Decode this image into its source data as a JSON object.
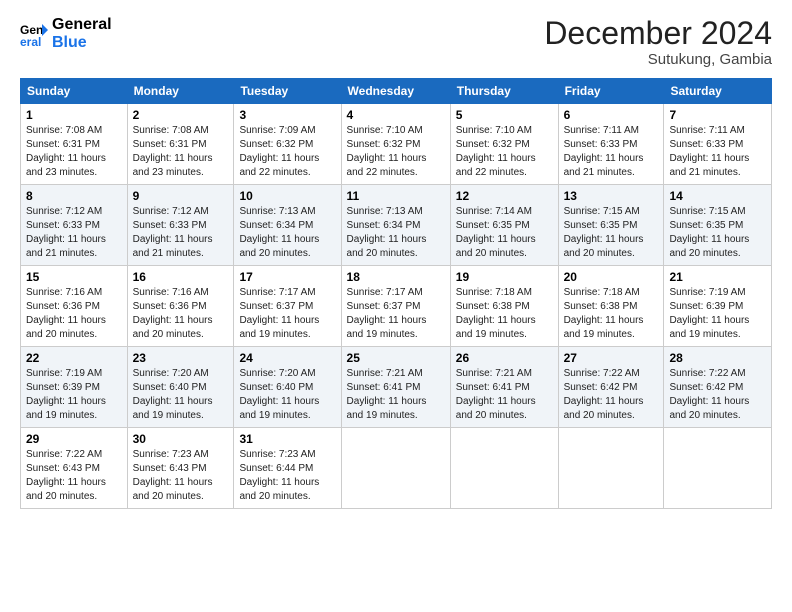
{
  "header": {
    "logo_line1": "General",
    "logo_line2": "Blue",
    "month_title": "December 2024",
    "location": "Sutukung, Gambia"
  },
  "weekdays": [
    "Sunday",
    "Monday",
    "Tuesday",
    "Wednesday",
    "Thursday",
    "Friday",
    "Saturday"
  ],
  "weeks": [
    [
      {
        "day": "1",
        "sunrise": "7:08 AM",
        "sunset": "6:31 PM",
        "daylight": "11 hours and 23 minutes."
      },
      {
        "day": "2",
        "sunrise": "7:08 AM",
        "sunset": "6:31 PM",
        "daylight": "11 hours and 23 minutes."
      },
      {
        "day": "3",
        "sunrise": "7:09 AM",
        "sunset": "6:32 PM",
        "daylight": "11 hours and 22 minutes."
      },
      {
        "day": "4",
        "sunrise": "7:10 AM",
        "sunset": "6:32 PM",
        "daylight": "11 hours and 22 minutes."
      },
      {
        "day": "5",
        "sunrise": "7:10 AM",
        "sunset": "6:32 PM",
        "daylight": "11 hours and 22 minutes."
      },
      {
        "day": "6",
        "sunrise": "7:11 AM",
        "sunset": "6:33 PM",
        "daylight": "11 hours and 21 minutes."
      },
      {
        "day": "7",
        "sunrise": "7:11 AM",
        "sunset": "6:33 PM",
        "daylight": "11 hours and 21 minutes."
      }
    ],
    [
      {
        "day": "8",
        "sunrise": "7:12 AM",
        "sunset": "6:33 PM",
        "daylight": "11 hours and 21 minutes."
      },
      {
        "day": "9",
        "sunrise": "7:12 AM",
        "sunset": "6:33 PM",
        "daylight": "11 hours and 21 minutes."
      },
      {
        "day": "10",
        "sunrise": "7:13 AM",
        "sunset": "6:34 PM",
        "daylight": "11 hours and 20 minutes."
      },
      {
        "day": "11",
        "sunrise": "7:13 AM",
        "sunset": "6:34 PM",
        "daylight": "11 hours and 20 minutes."
      },
      {
        "day": "12",
        "sunrise": "7:14 AM",
        "sunset": "6:35 PM",
        "daylight": "11 hours and 20 minutes."
      },
      {
        "day": "13",
        "sunrise": "7:15 AM",
        "sunset": "6:35 PM",
        "daylight": "11 hours and 20 minutes."
      },
      {
        "day": "14",
        "sunrise": "7:15 AM",
        "sunset": "6:35 PM",
        "daylight": "11 hours and 20 minutes."
      }
    ],
    [
      {
        "day": "15",
        "sunrise": "7:16 AM",
        "sunset": "6:36 PM",
        "daylight": "11 hours and 20 minutes."
      },
      {
        "day": "16",
        "sunrise": "7:16 AM",
        "sunset": "6:36 PM",
        "daylight": "11 hours and 20 minutes."
      },
      {
        "day": "17",
        "sunrise": "7:17 AM",
        "sunset": "6:37 PM",
        "daylight": "11 hours and 19 minutes."
      },
      {
        "day": "18",
        "sunrise": "7:17 AM",
        "sunset": "6:37 PM",
        "daylight": "11 hours and 19 minutes."
      },
      {
        "day": "19",
        "sunrise": "7:18 AM",
        "sunset": "6:38 PM",
        "daylight": "11 hours and 19 minutes."
      },
      {
        "day": "20",
        "sunrise": "7:18 AM",
        "sunset": "6:38 PM",
        "daylight": "11 hours and 19 minutes."
      },
      {
        "day": "21",
        "sunrise": "7:19 AM",
        "sunset": "6:39 PM",
        "daylight": "11 hours and 19 minutes."
      }
    ],
    [
      {
        "day": "22",
        "sunrise": "7:19 AM",
        "sunset": "6:39 PM",
        "daylight": "11 hours and 19 minutes."
      },
      {
        "day": "23",
        "sunrise": "7:20 AM",
        "sunset": "6:40 PM",
        "daylight": "11 hours and 19 minutes."
      },
      {
        "day": "24",
        "sunrise": "7:20 AM",
        "sunset": "6:40 PM",
        "daylight": "11 hours and 19 minutes."
      },
      {
        "day": "25",
        "sunrise": "7:21 AM",
        "sunset": "6:41 PM",
        "daylight": "11 hours and 19 minutes."
      },
      {
        "day": "26",
        "sunrise": "7:21 AM",
        "sunset": "6:41 PM",
        "daylight": "11 hours and 20 minutes."
      },
      {
        "day": "27",
        "sunrise": "7:22 AM",
        "sunset": "6:42 PM",
        "daylight": "11 hours and 20 minutes."
      },
      {
        "day": "28",
        "sunrise": "7:22 AM",
        "sunset": "6:42 PM",
        "daylight": "11 hours and 20 minutes."
      }
    ],
    [
      {
        "day": "29",
        "sunrise": "7:22 AM",
        "sunset": "6:43 PM",
        "daylight": "11 hours and 20 minutes."
      },
      {
        "day": "30",
        "sunrise": "7:23 AM",
        "sunset": "6:43 PM",
        "daylight": "11 hours and 20 minutes."
      },
      {
        "day": "31",
        "sunrise": "7:23 AM",
        "sunset": "6:44 PM",
        "daylight": "11 hours and 20 minutes."
      },
      null,
      null,
      null,
      null
    ]
  ]
}
